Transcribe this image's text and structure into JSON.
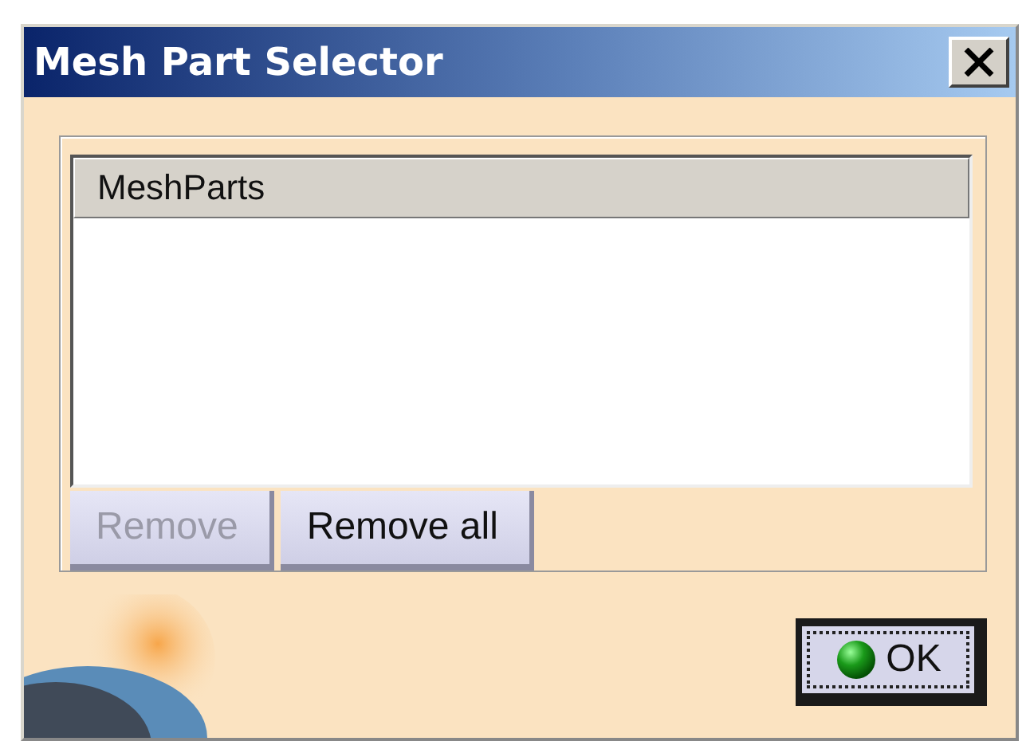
{
  "window": {
    "title": "Mesh Part Selector"
  },
  "list": {
    "columns": [
      "MeshParts"
    ]
  },
  "buttons": [
    {
      "label": "Remove",
      "disabled": true
    },
    {
      "label": "Remove all",
      "disabled": false
    }
  ],
  "ok_button": {
    "label": "OK"
  }
}
